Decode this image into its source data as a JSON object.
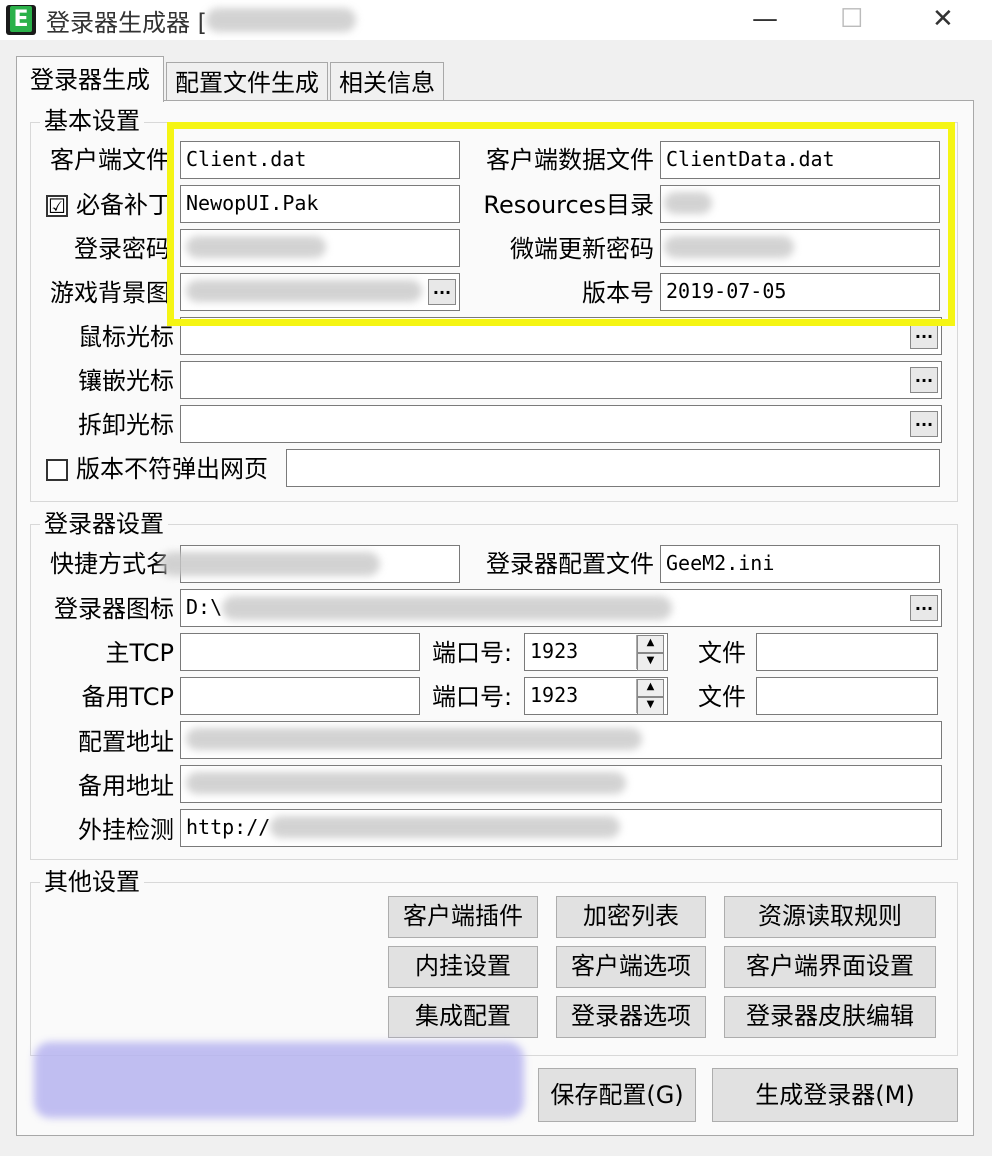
{
  "window": {
    "title": "登录器生成器 [",
    "minimize_glyph": "—",
    "maximize_glyph": "☐",
    "close_glyph": "✕",
    "icon_letter": "E"
  },
  "tabs": [
    "登录器生成",
    "配置文件生成",
    "相关信息"
  ],
  "basic": {
    "legend": "基本设置",
    "client_file_label": "客户端文件",
    "client_file_value": "Client.dat",
    "client_data_label": "客户端数据文件",
    "client_data_value": "ClientData.dat",
    "patch_label": "必备补丁",
    "patch_checked": "☑",
    "patch_value": "NewopUI.Pak",
    "resources_label": "Resources目录",
    "resources_value": "",
    "login_pw_label": "登录密码",
    "login_pw_value": "",
    "micro_pw_label": "微端更新密码",
    "micro_pw_value": "",
    "bg_label": "游戏背景图",
    "bg_value": "",
    "version_label": "版本号",
    "version_value": "2019-07-05",
    "mouse_cursor_label": "鼠标光标",
    "inlay_cursor_label": "镶嵌光标",
    "remove_cursor_label": "拆卸光标",
    "version_popup_label": "版本不符弹出网页",
    "browse_glyph": "..."
  },
  "login": {
    "legend": "登录器设置",
    "shortcut_label": "快捷方式名",
    "config_file_label": "登录器配置文件",
    "config_file_value": "GeeM2.ini",
    "icon_label": "登录器图标",
    "icon_value": "D:\\",
    "main_tcp_label": "主TCP",
    "backup_tcp_label": "备用TCP",
    "port_label": "端口号:",
    "port_main": "1923",
    "port_backup": "1923",
    "file_label": "文件",
    "config_addr_label": "配置地址",
    "backup_addr_label": "备用地址",
    "plugin_check_label": "外挂检测",
    "plugin_check_value": "http://"
  },
  "other": {
    "legend": "其他设置",
    "buttons": [
      "客户端插件",
      "加密列表",
      "资源读取规则",
      "内挂设置",
      "客户端选项",
      "客户端界面设置",
      "集成配置",
      "登录器选项",
      "登录器皮肤编辑"
    ]
  },
  "footer": {
    "save": "保存配置(G)",
    "generate": "生成登录器(M)"
  },
  "colors": {
    "highlight": "#f5f514",
    "icon_green": "#2bb14a"
  }
}
